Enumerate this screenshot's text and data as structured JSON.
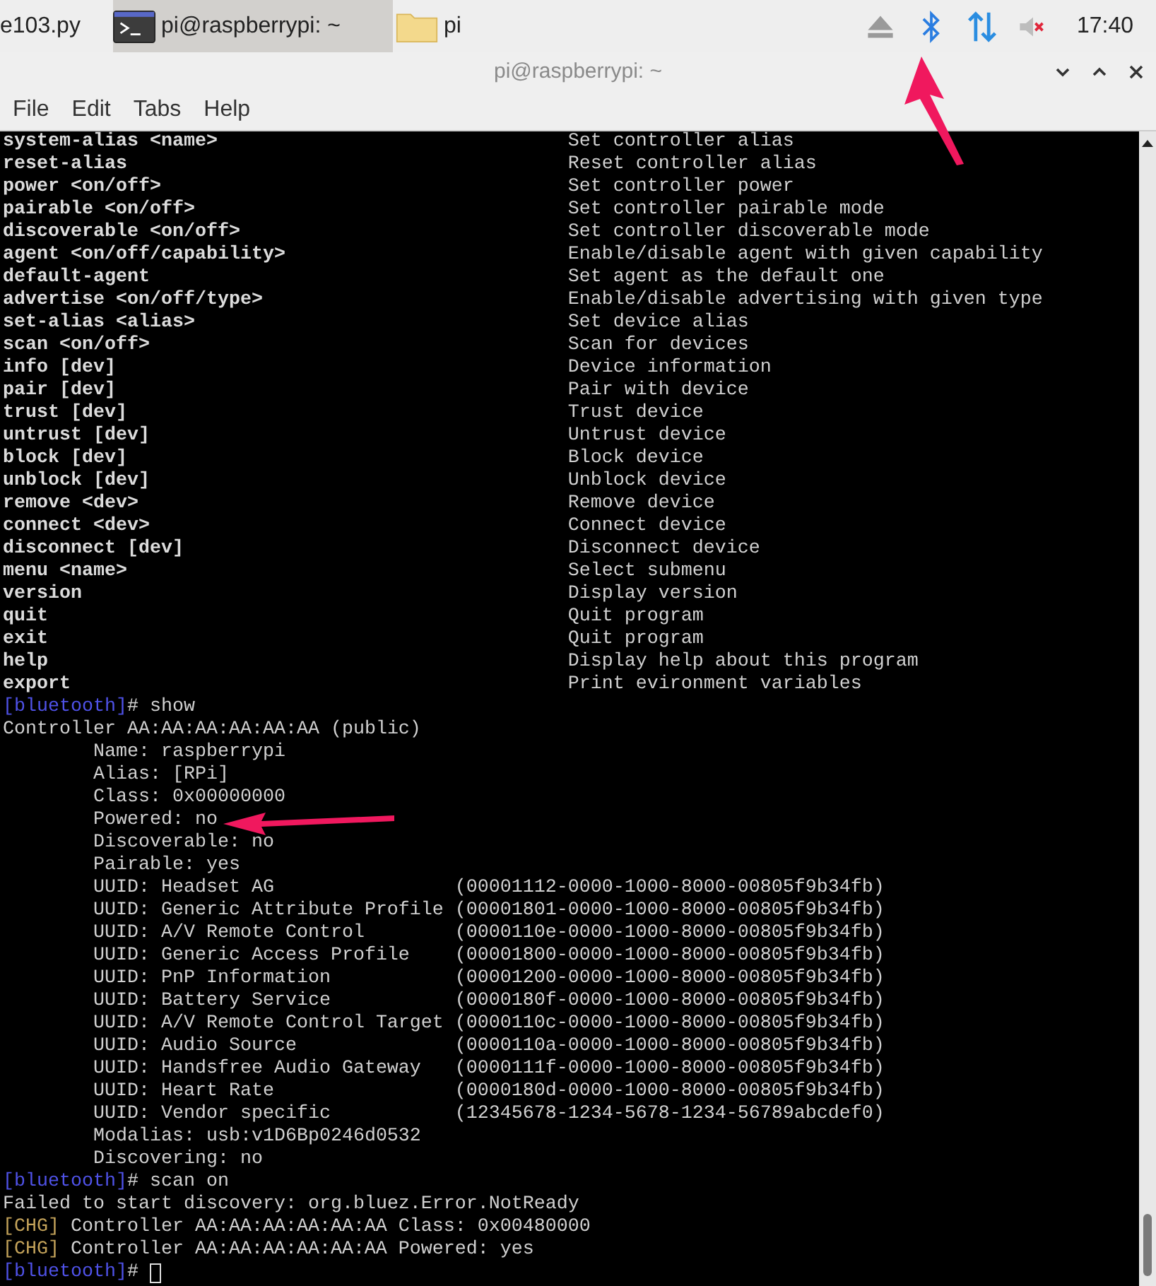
{
  "taskbar": {
    "windows": [
      {
        "label": "e103.py",
        "kind": "plain",
        "selected": false
      },
      {
        "label": "pi@raspberrypi: ~",
        "kind": "terminal",
        "selected": true
      },
      {
        "label": "pi",
        "kind": "folder",
        "selected": false
      }
    ],
    "volume": {
      "muted": true
    },
    "clock": "17:40"
  },
  "window": {
    "title": "pi@raspberrypi: ~"
  },
  "menu": [
    "File",
    "Edit",
    "Tabs",
    "Help"
  ],
  "help": [
    {
      "command": "system-alias <name>",
      "description": "Set controller alias"
    },
    {
      "command": "reset-alias",
      "description": "Reset controller alias"
    },
    {
      "command": "power <on/off>",
      "description": "Set controller power"
    },
    {
      "command": "pairable <on/off>",
      "description": "Set controller pairable mode"
    },
    {
      "command": "discoverable <on/off>",
      "description": "Set controller discoverable mode"
    },
    {
      "command": "agent <on/off/capability>",
      "description": "Enable/disable agent with given capability"
    },
    {
      "command": "default-agent",
      "description": "Set agent as the default one"
    },
    {
      "command": "advertise <on/off/type>",
      "description": "Enable/disable advertising with given type"
    },
    {
      "command": "set-alias <alias>",
      "description": "Set device alias"
    },
    {
      "command": "scan <on/off>",
      "description": "Scan for devices"
    },
    {
      "command": "info [dev]",
      "description": "Device information"
    },
    {
      "command": "pair [dev]",
      "description": "Pair with device"
    },
    {
      "command": "trust [dev]",
      "description": "Trust device"
    },
    {
      "command": "untrust [dev]",
      "description": "Untrust device"
    },
    {
      "command": "block [dev]",
      "description": "Block device"
    },
    {
      "command": "unblock [dev]",
      "description": "Unblock device"
    },
    {
      "command": "remove <dev>",
      "description": "Remove device"
    },
    {
      "command": "connect <dev>",
      "description": "Connect device"
    },
    {
      "command": "disconnect [dev]",
      "description": "Disconnect device"
    },
    {
      "command": "menu <name>",
      "description": "Select submenu"
    },
    {
      "command": "version",
      "description": "Display version"
    },
    {
      "command": "quit",
      "description": "Quit program"
    },
    {
      "command": "exit",
      "description": "Quit program"
    },
    {
      "command": "help",
      "description": "Display help about this program"
    },
    {
      "command": "export",
      "description": "Print evironment variables"
    }
  ],
  "session": [
    {
      "kind": "prompt",
      "prompt": "[bluetooth]",
      "command": "# show"
    },
    {
      "kind": "output",
      "text": "Controller AA:AA:AA:AA:AA:AA (public)"
    },
    {
      "kind": "field",
      "text": "Name: raspberrypi"
    },
    {
      "kind": "field",
      "text": "Alias: [RPi]"
    },
    {
      "kind": "field",
      "text": "Class: 0x00000000"
    },
    {
      "kind": "field",
      "text": "Powered: no"
    },
    {
      "kind": "field",
      "text": "Discoverable: no"
    },
    {
      "kind": "field",
      "text": "Pairable: yes"
    },
    {
      "kind": "uuid",
      "name": "UUID: Headset AG",
      "value": "(00001112-0000-1000-8000-00805f9b34fb)"
    },
    {
      "kind": "uuid",
      "name": "UUID: Generic Attribute Profile",
      "value": "(00001801-0000-1000-8000-00805f9b34fb)"
    },
    {
      "kind": "uuid",
      "name": "UUID: A/V Remote Control",
      "value": "(0000110e-0000-1000-8000-00805f9b34fb)"
    },
    {
      "kind": "uuid",
      "name": "UUID: Generic Access Profile",
      "value": "(00001800-0000-1000-8000-00805f9b34fb)"
    },
    {
      "kind": "uuid",
      "name": "UUID: PnP Information",
      "value": "(00001200-0000-1000-8000-00805f9b34fb)"
    },
    {
      "kind": "uuid",
      "name": "UUID: Battery Service",
      "value": "(0000180f-0000-1000-8000-00805f9b34fb)"
    },
    {
      "kind": "uuid",
      "name": "UUID: A/V Remote Control Target",
      "value": "(0000110c-0000-1000-8000-00805f9b34fb)"
    },
    {
      "kind": "uuid",
      "name": "UUID: Audio Source",
      "value": "(0000110a-0000-1000-8000-00805f9b34fb)"
    },
    {
      "kind": "uuid",
      "name": "UUID: Handsfree Audio Gateway",
      "value": "(0000111f-0000-1000-8000-00805f9b34fb)"
    },
    {
      "kind": "uuid",
      "name": "UUID: Heart Rate",
      "value": "(0000180d-0000-1000-8000-00805f9b34fb)"
    },
    {
      "kind": "uuid",
      "name": "UUID: Vendor specific",
      "value": "(12345678-1234-5678-1234-56789abcdef0)"
    },
    {
      "kind": "field",
      "text": "Modalias: usb:v1D6Bp0246d0532"
    },
    {
      "kind": "field",
      "text": "Discovering: no"
    },
    {
      "kind": "prompt",
      "prompt": "[bluetooth]",
      "command": "# scan on"
    },
    {
      "kind": "output",
      "text": "Failed to start discovery: org.bluez.Error.NotReady"
    },
    {
      "kind": "chg",
      "tag": "[CHG]",
      "text": "Controller AA:AA:AA:AA:AA:AA Class: 0x00480000"
    },
    {
      "kind": "chg",
      "tag": "[CHG]",
      "text": "Controller AA:AA:AA:AA:AA:AA Powered: yes"
    },
    {
      "kind": "input",
      "prompt": "[bluetooth]",
      "command": "#"
    }
  ]
}
